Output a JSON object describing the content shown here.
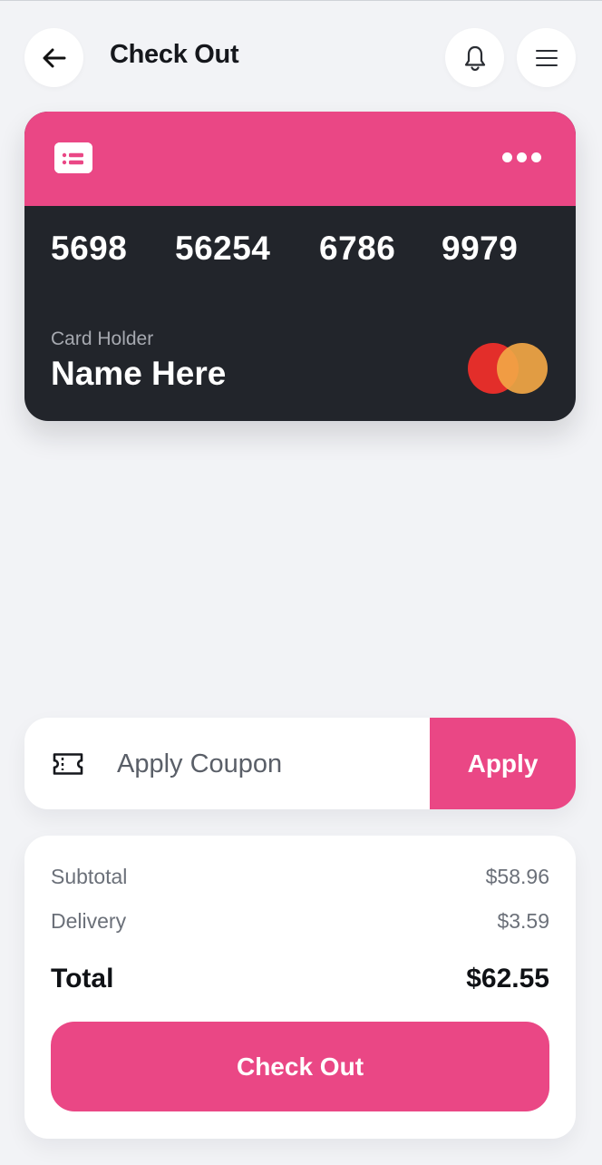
{
  "header": {
    "title": "Check Out",
    "back_icon": "arrow-left-icon",
    "notification_icon": "bell-icon",
    "menu_icon": "hamburger-menu-icon"
  },
  "card": {
    "number_groups": [
      "5698",
      "56254",
      "6786",
      "9979"
    ],
    "holder_label": "Card Holder",
    "holder_name": "Name Here",
    "brand": "mastercard",
    "colors": {
      "top": "#ea4785",
      "body": "#22252b",
      "mastercard_red": "#e32e2a",
      "mastercard_orange": "#f2a645"
    }
  },
  "coupon": {
    "placeholder": "Apply Coupon",
    "value": "",
    "apply_label": "Apply",
    "icon": "ticket-icon"
  },
  "summary": {
    "subtotal_label": "Subtotal",
    "subtotal_value": "$58.96",
    "delivery_label": "Delivery",
    "delivery_value": "$3.59",
    "total_label": "Total",
    "total_value": "$62.55"
  },
  "checkout_button": {
    "label": "Check Out"
  },
  "theme": {
    "accent": "#ea4785",
    "background": "#f2f3f6",
    "surface": "#ffffff"
  }
}
